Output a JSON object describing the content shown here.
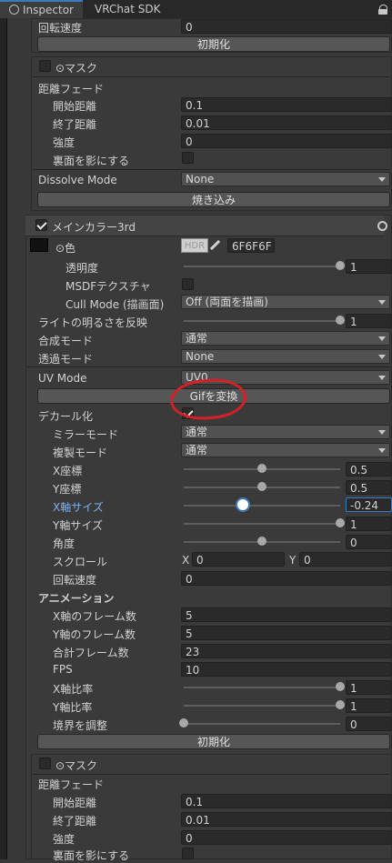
{
  "tabs": [
    {
      "label": "Inspector"
    },
    {
      "label": "VRChat SDK"
    }
  ],
  "top": {
    "rotation_speed_label": "回転速度",
    "rotation_speed_value": "0",
    "reset_button": "初期化",
    "mask_label": "⊙マスク",
    "distance_fade_label": "距離フェード",
    "start_distance_label": "開始距離",
    "start_distance_value": "0.1",
    "end_distance_label": "終了距離",
    "end_distance_value": "0.01",
    "strength_label": "強度",
    "strength_value": "0",
    "backface_shadow_label": "裏面を影にする",
    "dissolve_mode_label": "Dissolve Mode",
    "dissolve_mode_value": "None",
    "bake_button": "焼き込み"
  },
  "main3rd": {
    "title": "メインカラー3rd",
    "color_label": "⊙色",
    "hdr_label": "HDR",
    "color_hex": "6F6F6F",
    "transparency_label": "透明度",
    "transparency_value": "1",
    "transparency_fraction": 1.0,
    "msdf_label": "MSDFテクスチャ",
    "cull_label": "Cull Mode (描画面)",
    "cull_value": "Off (両面を描画)",
    "light_label": "ライトの明るさを反映",
    "light_value": "1",
    "light_fraction": 1.0,
    "blend_label": "合成モード",
    "blend_value": "通常",
    "transparent_label": "透過モード",
    "transparent_value": "None",
    "uv_label": "UV Mode",
    "uv_value": "UV0",
    "gif_button": "Gifを変換",
    "decal_label": "デカール化",
    "mirror_label": "ミラーモード",
    "mirror_value": "通常",
    "copy_label": "複製モード",
    "copy_value": "通常",
    "xpos_label": "X座標",
    "xpos_value": "0.5",
    "xpos_fraction": 0.5,
    "ypos_label": "Y座標",
    "ypos_value": "0.5",
    "ypos_fraction": 0.5,
    "xsize_label": "X軸サイズ",
    "xsize_value": "-0.24",
    "xsize_fraction": 0.38,
    "ysize_label": "Y軸サイズ",
    "ysize_value": "1",
    "ysize_fraction": 1.0,
    "angle_label": "角度",
    "angle_value": "0",
    "angle_fraction": 0.5,
    "scroll_label": "スクロール",
    "scroll_x_label": "X",
    "scroll_x_value": "0",
    "scroll_y_label": "Y",
    "scroll_y_value": "0",
    "rotspeed_label": "回転速度",
    "rotspeed_value": "0",
    "animation_label": "アニメーション",
    "xframes_label": "X軸のフレーム数",
    "xframes_value": "5",
    "yframes_label": "Y軸のフレーム数",
    "yframes_value": "5",
    "total_label": "合計フレーム数",
    "total_value": "23",
    "fps_label": "FPS",
    "fps_value": "10",
    "xratio_label": "X軸比率",
    "xratio_value": "1",
    "xratio_fraction": 1.0,
    "yratio_label": "Y軸比率",
    "yratio_value": "1",
    "yratio_fraction": 1.0,
    "border_label": "境界を調整",
    "border_value": "0",
    "border_fraction": 0.0,
    "reset_button": "初期化"
  },
  "bottom": {
    "mask_label": "⊙マスク",
    "distance_fade_label": "距離フェード",
    "start_distance_label": "開始距離",
    "start_distance_value": "0.1",
    "end_distance_label": "終了距離",
    "end_distance_value": "0.01",
    "strength_label": "強度",
    "strength_value": "0",
    "backface_shadow_label": "裏面を影にする"
  },
  "colors": {
    "accent": "#3a79bb",
    "highlight_text": "#7fb1ee",
    "annotation": "#d71f26"
  }
}
